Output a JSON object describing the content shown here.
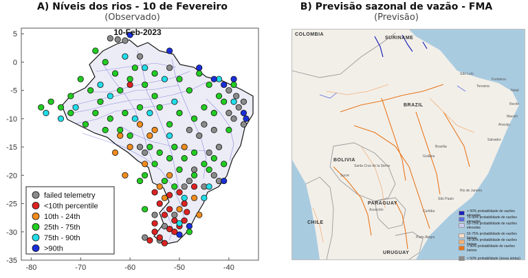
{
  "panel_a": {
    "title": "A) Níveis dos rios - 10 de Fevereiro",
    "subtitle": "(Observado)",
    "chart_data": {
      "type": "scatter",
      "title": "10-Feb-2023",
      "xlim": [
        -82,
        -34
      ],
      "ylim": [
        -35,
        6
      ],
      "xticks": [
        -80,
        -70,
        -60,
        -50,
        -40
      ],
      "yticks": [
        5,
        0,
        -5,
        -10,
        -15,
        -20,
        -25,
        -30,
        -35
      ],
      "grid": false,
      "legend_position": "bottom-left",
      "series": [
        {
          "name": "failed telemetry",
          "color": "#8a8a8a",
          "points": [
            [
              -64,
              4.2
            ],
            [
              -62.5,
              4.0
            ],
            [
              -61,
              3.8
            ],
            [
              -58,
              1
            ],
            [
              -52,
              -1
            ],
            [
              -40,
              -5
            ],
            [
              -38.5,
              -6
            ],
            [
              -37,
              -7
            ],
            [
              -38,
              -8
            ],
            [
              -39,
              -10
            ],
            [
              -37,
              -11
            ],
            [
              -48,
              -12
            ],
            [
              -46,
              -13
            ],
            [
              -45,
              -11
            ],
            [
              -42,
              -15
            ],
            [
              -44,
              -16
            ],
            [
              -47,
              -19
            ],
            [
              -43,
              -20
            ],
            [
              -48,
              -21
            ],
            [
              -42,
              -21
            ],
            [
              -49,
              -22
            ],
            [
              -45,
              -22
            ],
            [
              -55,
              -27
            ],
            [
              -51,
              -27
            ],
            [
              -53,
              -29
            ],
            [
              -57,
              -31
            ],
            [
              -54,
              -31.5
            ],
            [
              -58,
              -15
            ],
            [
              -57,
              -16
            ],
            [
              -40,
              -9
            ],
            [
              -43,
              -12
            ]
          ]
        },
        {
          "name": "<10th percentile",
          "color": "#dd2222",
          "points": [
            [
              -55,
              -23
            ],
            [
              -52,
              -23.5
            ],
            [
              -50,
              -23
            ],
            [
              -54,
              -25
            ],
            [
              -52,
              -26
            ],
            [
              -49,
              -25
            ],
            [
              -53,
              -27
            ],
            [
              -51,
              -28
            ],
            [
              -55,
              -28.5
            ],
            [
              -49,
              -28
            ],
            [
              -52,
              -29.5
            ],
            [
              -55,
              -30
            ],
            [
              -54,
              -31
            ],
            [
              -51,
              -30
            ],
            [
              -53,
              -32
            ],
            [
              -56,
              -31.5
            ],
            [
              -50,
              -29
            ],
            [
              -48.5,
              -26.5
            ],
            [
              -47,
              -22
            ],
            [
              -60,
              -4
            ]
          ]
        },
        {
          "name": "10th - 24th",
          "color": "#f08c1e",
          "points": [
            [
              -58,
              -11
            ],
            [
              -56,
              -13
            ],
            [
              -62,
              -13
            ],
            [
              -60,
              -15
            ],
            [
              -57,
              -18
            ],
            [
              -52,
              -20
            ],
            [
              -54,
              -22
            ],
            [
              -50,
              -26
            ],
            [
              -47,
              -24
            ],
            [
              -46,
              -27
            ],
            [
              -53,
              -24
            ],
            [
              -49,
              -15
            ],
            [
              -55,
              -12
            ],
            [
              -63,
              -16
            ],
            [
              -61,
              -20
            ]
          ]
        },
        {
          "name": "25th - 75th",
          "color": "#22cc22",
          "points": [
            [
              -67,
              2
            ],
            [
              -65,
              0
            ],
            [
              -70,
              -3
            ],
            [
              -68,
              -5
            ],
            [
              -66,
              -7
            ],
            [
              -62,
              -5
            ],
            [
              -60,
              -3
            ],
            [
              -57,
              -4
            ],
            [
              -55,
              -6
            ],
            [
              -50,
              -3
            ],
            [
              -48,
              -5
            ],
            [
              -46,
              -2
            ],
            [
              -44,
              -4
            ],
            [
              -42,
              -6
            ],
            [
              -45,
              -8
            ],
            [
              -47,
              -10
            ],
            [
              -50,
              -9
            ],
            [
              -52,
              -11
            ],
            [
              -54,
              -8
            ],
            [
              -58,
              -8
            ],
            [
              -61,
              -9
            ],
            [
              -64,
              -10
            ],
            [
              -67,
              -9
            ],
            [
              -69,
              -11
            ],
            [
              -72,
              -9
            ],
            [
              -74,
              -8
            ],
            [
              -76,
              -7
            ],
            [
              -78,
              -8
            ],
            [
              -62,
              -12
            ],
            [
              -60,
              -13
            ],
            [
              -56,
              -15
            ],
            [
              -54,
              -16
            ],
            [
              -51,
              -15
            ],
            [
              -49,
              -17
            ],
            [
              -47,
              -16
            ],
            [
              -45,
              -18
            ],
            [
              -43,
              -17
            ],
            [
              -50,
              -19
            ],
            [
              -52,
              -17
            ],
            [
              -55,
              -18
            ],
            [
              -57,
              -20
            ],
            [
              -53,
              -21
            ],
            [
              -51,
              -22
            ],
            [
              -47,
              -20
            ],
            [
              -44,
              -19
            ],
            [
              -41,
              -18
            ],
            [
              -40,
              -12
            ],
            [
              -43,
              -9
            ],
            [
              -41,
              -7
            ],
            [
              -39,
              -4
            ],
            [
              -55,
              -2
            ],
            [
              -59,
              -1
            ],
            [
              -63,
              -2
            ],
            [
              -72,
              -6
            ],
            [
              -65,
              -12
            ],
            [
              -58,
              -21
            ],
            [
              -48,
              -30
            ],
            [
              -57,
              -26
            ]
          ]
        },
        {
          "name": "75th - 90th",
          "color": "#22dde8",
          "points": [
            [
              -61,
              1
            ],
            [
              -57,
              -1
            ],
            [
              -53,
              -3
            ],
            [
              -64,
              -6
            ],
            [
              -66,
              -4
            ],
            [
              -71,
              -8
            ],
            [
              -74,
              -10
            ],
            [
              -77,
              -9
            ],
            [
              -59,
              -10
            ],
            [
              -56,
              -9
            ],
            [
              -51,
              -7
            ],
            [
              -42,
              -3
            ],
            [
              -39,
              -7
            ],
            [
              -52,
              -13
            ],
            [
              -45,
              -24
            ],
            [
              -49,
              -24
            ],
            [
              -44,
              -22
            ],
            [
              -50,
              -28.5
            ]
          ]
        },
        {
          "name": ">90th",
          "color": "#1a2ed8",
          "points": [
            [
              -60,
              4.8
            ],
            [
              -52,
              2
            ],
            [
              -46,
              -1
            ],
            [
              -43,
              -3
            ],
            [
              -41,
              -4
            ],
            [
              -37,
              -9
            ],
            [
              -36.5,
              -10
            ],
            [
              -39,
              -3
            ],
            [
              -48,
              -29
            ],
            [
              -50,
              -30.5
            ],
            [
              -41,
              -21
            ]
          ]
        }
      ]
    },
    "legend": [
      {
        "label": "failed telemetry",
        "color": "#8a8a8a"
      },
      {
        "label": "<10th percentile",
        "color": "#dd2222"
      },
      {
        "label": "10th - 24th",
        "color": "#f08c1e"
      },
      {
        "label": "25th - 75th",
        "color": "#22cc22"
      },
      {
        "label": "75th - 90th",
        "color": "#22dde8"
      },
      {
        "label": ">90th",
        "color": "#1a2ed8"
      }
    ]
  },
  "panel_b": {
    "title": "B) Previsão sazonal de vazão - FMA",
    "subtitle": "(Previsão)",
    "map_labels": {
      "colombia": "COLOMBIA",
      "suriname": "SURINAME",
      "brazil": "BRAZIL",
      "bolivia": "BOLIVIA",
      "paraguay": "PARAGUAY",
      "chile": "CHILE",
      "uruguay": "URUGUAY",
      "sao_luis": "São Luís",
      "fortaleza": "Fortaleza",
      "natal": "Natal",
      "teresina": "Teresina",
      "recife": "Recife",
      "maceio": "Maceió",
      "aracaju": "Aracaju",
      "salvador": "Salvador",
      "brasilia": "Brasília",
      "goiania": "Goiânia",
      "santa_cruz": "Santa Cruz de la Sierra",
      "sucre": "Sucre",
      "asuncion": "Asunción",
      "rio": "Rio de Janeiro",
      "sao_paulo": "São Paulo",
      "curitiba": "Curitiba",
      "porto_alegre": "Porto Alegre"
    },
    "legend": [
      {
        "label": "> 90% probabilidade de vazões elevadas",
        "color": "#1a22b8"
      },
      {
        "label": "75-90% probabilidade de vazões elevadas",
        "color": "#5a6be0"
      },
      {
        "label": "50-75% probabilidade de vazões elevadas",
        "color": "#c9ccef"
      },
      {
        "label": "50-75% probabilidade de vazões baixas",
        "color": "#f7dcc8"
      },
      {
        "label": "75-90% probabilidade de vazões baixas",
        "color": "#f3b27a"
      },
      {
        "label": "> 90% probabilidade de vazões baixas",
        "color": "#e8761a"
      },
      {
        "label": "> 50% probabilidade (áreas áridas)",
        "color": "#8a8a8a"
      }
    ]
  }
}
